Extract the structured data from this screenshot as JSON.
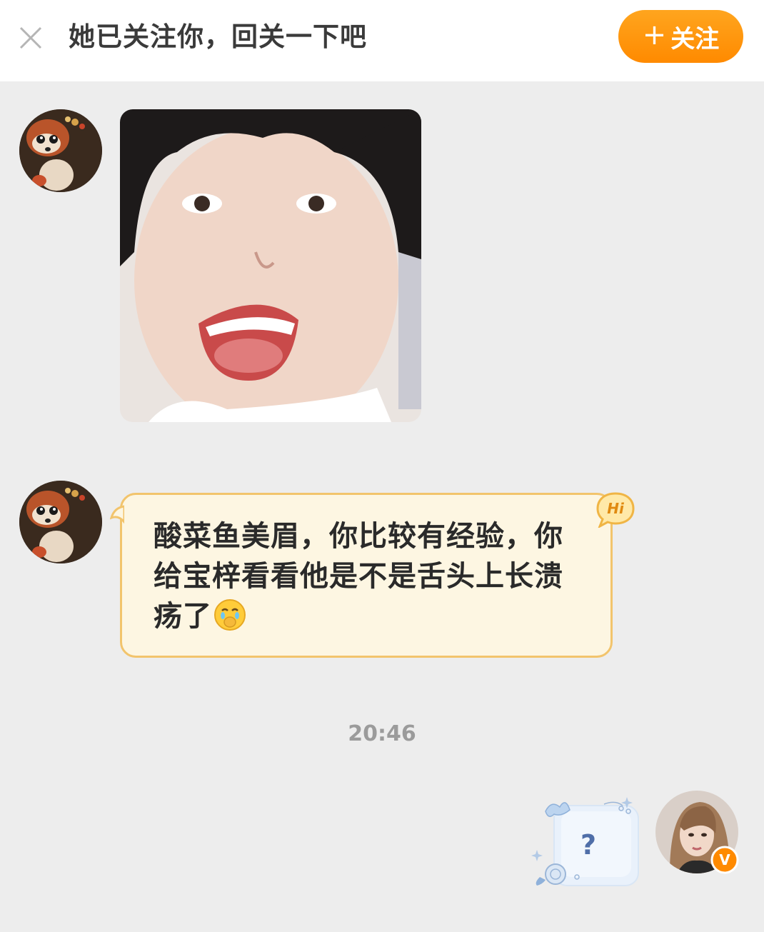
{
  "header": {
    "close_icon": "close-icon",
    "tip": "她已关注你，回关一下吧",
    "follow_plus": "+",
    "follow_label": "关注",
    "accent": "#ff9a0e"
  },
  "messages": [
    {
      "sender": "other",
      "type": "image",
      "avatar": "red-panda-avatar"
    },
    {
      "sender": "other",
      "type": "text",
      "text": "酸菜鱼美眉，你比较有经验，你给宝梓看看他是不是舌头上长溃疡了",
      "emoji": "crying-face-emoji",
      "badge": "Hi"
    },
    {
      "sender": "self",
      "type": "sticker",
      "sticker_text": "?",
      "avatar": "user-avatar",
      "verified_badge": "V"
    }
  ],
  "timestamp": "20:46"
}
